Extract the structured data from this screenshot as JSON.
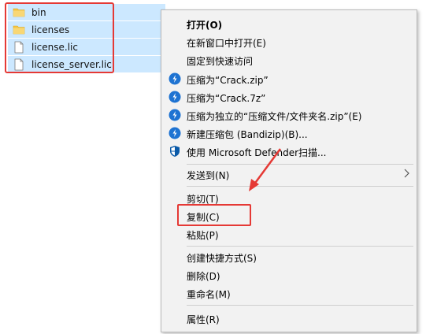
{
  "explorer": {
    "files": [
      {
        "name": "bin",
        "type": "folder"
      },
      {
        "name": "licenses",
        "type": "folder"
      },
      {
        "name": "license.lic",
        "type": "file"
      },
      {
        "name": "license_server.lic",
        "type": "file"
      }
    ]
  },
  "context_menu": {
    "items": [
      {
        "label": "打开(O)",
        "bold": true
      },
      {
        "label": "在新窗口中打开(E)"
      },
      {
        "label": "固定到快速访问"
      },
      {
        "label": "压缩为“Crack.zip”",
        "icon": "bandizip-icon"
      },
      {
        "label": "压缩为“Crack.7z”",
        "icon": "bandizip-icon"
      },
      {
        "label": "压缩为独立的“压缩文件/文件夹名.zip”(E)",
        "icon": "bandizip-icon"
      },
      {
        "label": "新建压缩包 (Bandizip)(B)...",
        "icon": "bandizip-icon"
      },
      {
        "label": "使用 Microsoft Defender扫描...",
        "icon": "defender-shield-icon"
      },
      {
        "label": "发送到(N)",
        "submenu": true
      },
      {
        "label": "剪切(T)"
      },
      {
        "label": "复制(C)"
      },
      {
        "label": "粘贴(P)"
      },
      {
        "label": "创建快捷方式(S)"
      },
      {
        "label": "删除(D)"
      },
      {
        "label": "重命名(M)"
      },
      {
        "label": "属性(R)"
      }
    ]
  },
  "colors": {
    "selection": "#cce8ff",
    "highlight_red": "#e53935",
    "bandizip_blue": "#1e73d2",
    "defender_blue": "#0a5aa8",
    "folder_yellow": "#f4c542"
  }
}
